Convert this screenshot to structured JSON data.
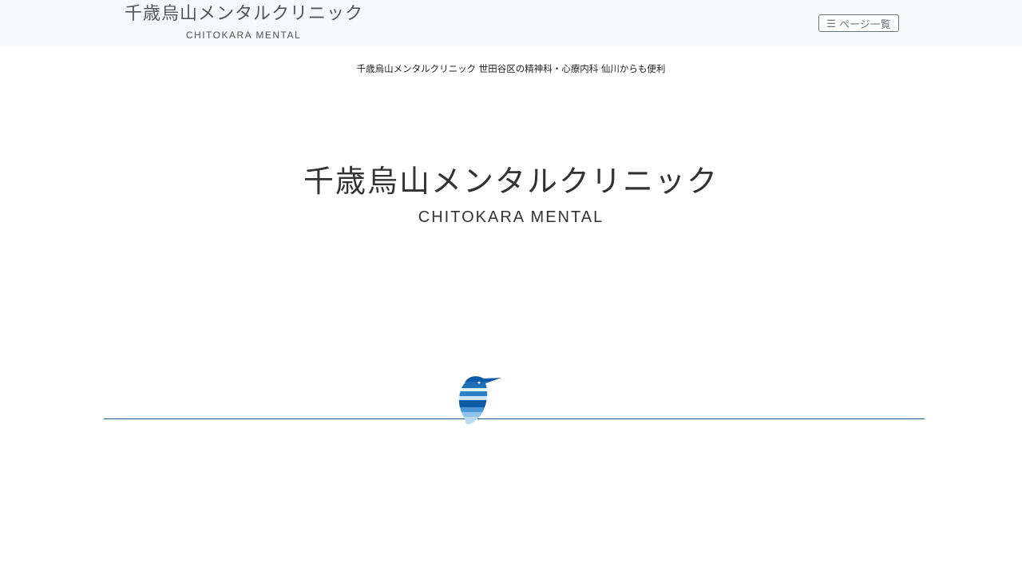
{
  "header": {
    "brand_jp": "千歳烏山メンタルクリニック",
    "brand_en": "CHITOKARA MENTAL",
    "menu_label": "ページ一覧",
    "menu_icon": "hamburger-icon"
  },
  "tagline": "千歳烏山メンタルクリニック 世田谷区の精神科・心療内科 仙川からも便利",
  "hero": {
    "title": "千歳烏山メンタルクリニック",
    "subtitle": "CHITOKARA MENTAL"
  },
  "colors": {
    "header_bg": "#f7f8f9",
    "divider": "#1f5a8a",
    "bird_dark": "#0d5aa7",
    "bird_light": "#8fc3ea"
  }
}
